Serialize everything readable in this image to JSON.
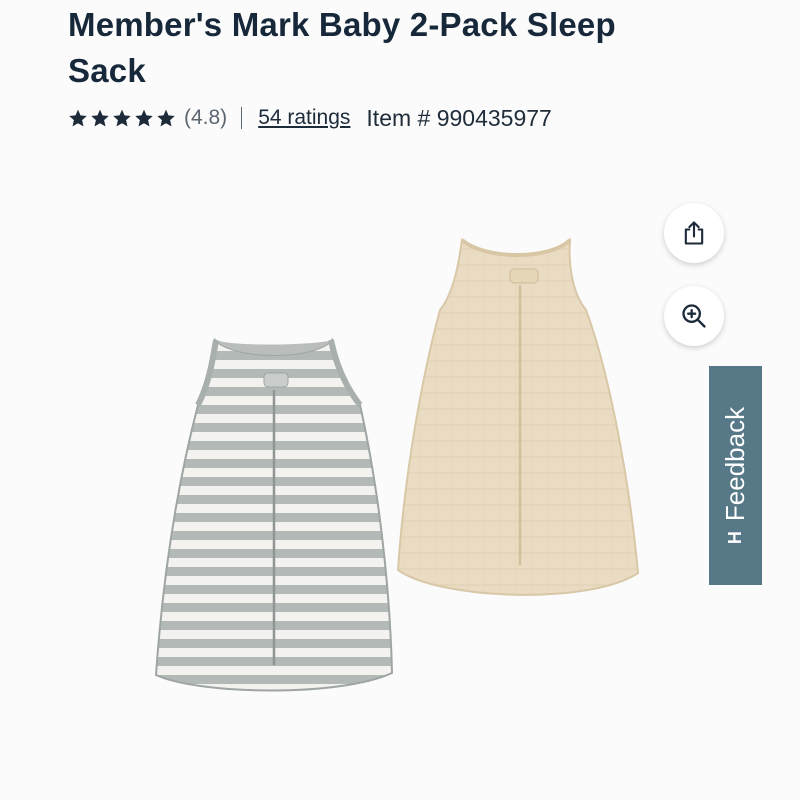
{
  "product": {
    "title": "Member's Mark Baby 2-Pack Sleep Sack",
    "rating_value": "(4.8)",
    "stars_filled": 5,
    "ratings_count_label": "54 ratings",
    "item_number_label": "Item # 990435977"
  },
  "actions": {
    "share_icon": "share-icon",
    "zoom_icon": "zoom-in-icon"
  },
  "feedback_tab": {
    "label": "Feedback",
    "icon_glyph": "H"
  },
  "colors": {
    "title": "#16283a",
    "feedback_bg": "#567887",
    "stripe_grey": "#b3b9b7",
    "beige_sack": "#eadcc2"
  }
}
